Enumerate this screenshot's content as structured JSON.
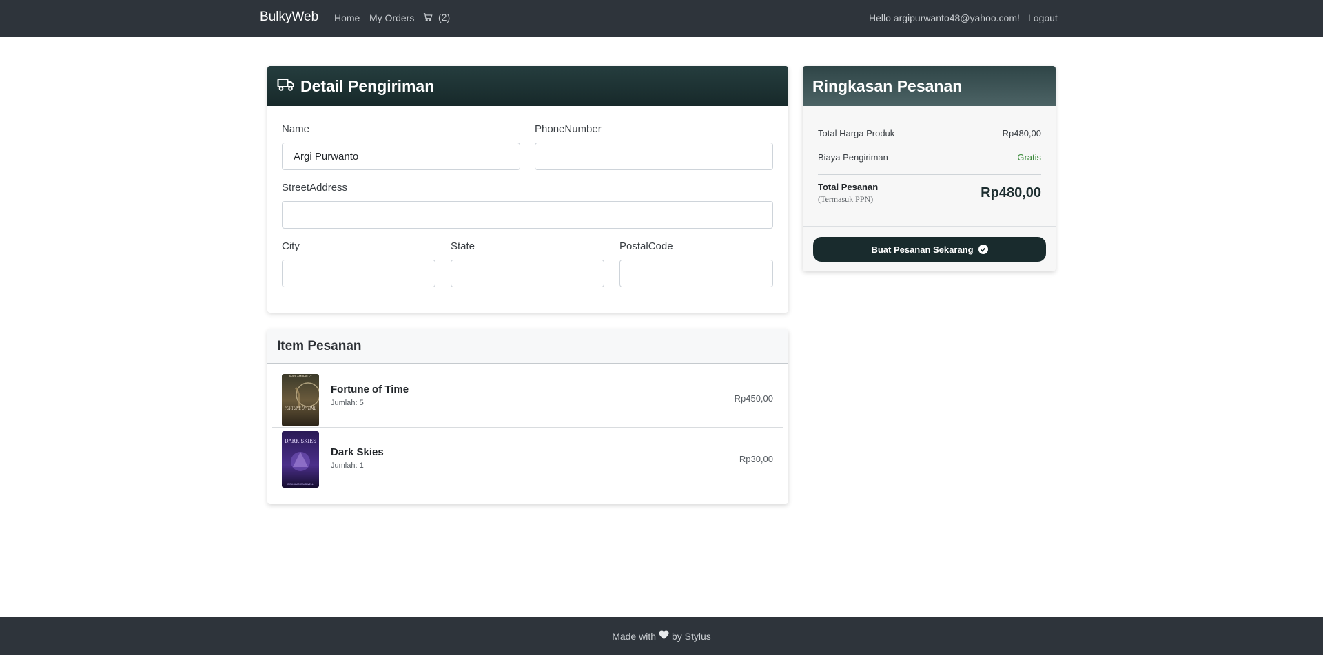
{
  "navbar": {
    "brand": "BulkyWeb",
    "home": "Home",
    "my_orders": "My Orders",
    "cart_icon": "cart-icon",
    "cart_count": "(2)",
    "greeting": "Hello argipurwanto48@yahoo.com!",
    "logout": "Logout"
  },
  "shipping": {
    "title": "Detail Pengiriman",
    "icon": "truck-icon",
    "fields": {
      "name": {
        "label": "Name",
        "value": "Argi Purwanto"
      },
      "phone": {
        "label": "PhoneNumber",
        "value": ""
      },
      "street": {
        "label": "StreetAddress",
        "value": ""
      },
      "city": {
        "label": "City",
        "value": ""
      },
      "state": {
        "label": "State",
        "value": ""
      },
      "postal": {
        "label": "PostalCode",
        "value": ""
      }
    }
  },
  "summary": {
    "title": "Ringkasan Pesanan",
    "product_total_label": "Total Harga Produk",
    "product_total_value": "Rp480,00",
    "shipping_label": "Biaya Pengiriman",
    "shipping_value": "Gratis",
    "order_total_label": "Total Pesanan",
    "order_total_note": "(Termasuk PPN)",
    "order_total_value": "Rp480,00",
    "button_label": "Buat Pesanan Sekarang",
    "button_icon": "check-circle-icon",
    "colors": {
      "header": "#253d3e",
      "button": "#192b2d",
      "free_text": "#3a8a3a"
    }
  },
  "items": {
    "title": "Item Pesanan",
    "list": [
      {
        "title": "Fortune of Time",
        "qty": "Jumlah: 5",
        "price": "Rp450,00",
        "cover_author": "ABBY AMBERLEY",
        "cover_title": "FORTUNE OF TIME"
      },
      {
        "title": "Dark Skies",
        "qty": "Jumlah: 1",
        "price": "Rp30,00",
        "cover_title": "DARK SKIES",
        "cover_author": "DOUGLAS CALDWELL"
      }
    ]
  },
  "footer": {
    "prefix": "Made with",
    "icon": "heart-icon",
    "suffix": "by Stylus"
  }
}
